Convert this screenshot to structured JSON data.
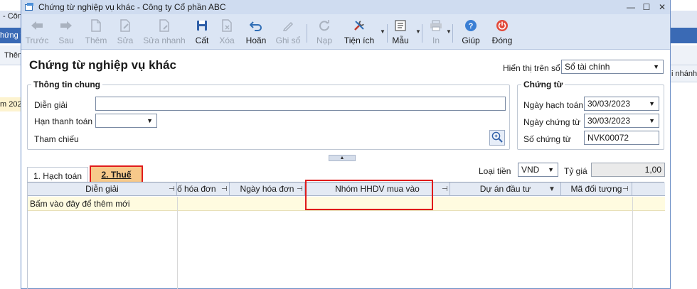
{
  "background": {
    "cong_text": "- Công",
    "nav_text": "hứng t",
    "them_text": "Thêm",
    "row_text": "m 202",
    "right_header": "i nhánh"
  },
  "window": {
    "title": "Chứng từ nghiệp vụ khác - Công ty Cổ phần ABC",
    "minimize": "—",
    "maximize": "☐",
    "close": "✕"
  },
  "toolbar": {
    "truoc": "Trước",
    "sau": "Sau",
    "them": "Thêm",
    "sua": "Sửa",
    "sua_nhanh": "Sửa nhanh",
    "cat": "Cất",
    "xoa": "Xóa",
    "hoan": "Hoãn",
    "ghi_so": "Ghi sổ",
    "nap": "Nạp",
    "tien_ich": "Tiện ích",
    "mau": "Mẫu",
    "in": "In",
    "giup": "Giúp",
    "dong": "Đóng"
  },
  "page": {
    "title": "Chứng từ nghiệp vụ khác",
    "hien_thi_label": "Hiển thị trên sổ",
    "hien_thi_value": "Sổ tài chính"
  },
  "thong_tin_chung": {
    "title": "Thông tin chung",
    "dien_giai_label": "Diễn giải",
    "dien_giai_value": "",
    "han_thanh_toan_label": "Hạn thanh toán",
    "han_thanh_toan_value": "",
    "tham_chieu_label": "Tham chiếu"
  },
  "chung_tu": {
    "title": "Chứng từ",
    "ngay_hach_toan_label": "Ngày hạch toán",
    "ngay_hach_toan_value": "30/03/2023",
    "ngay_chung_tu_label": "Ngày chứng từ",
    "ngay_chung_tu_value": "30/03/2023",
    "so_chung_tu_label": "Số chứng từ",
    "so_chung_tu_value": "NVK00072"
  },
  "tabs": {
    "hach_toan": "1. Hạch toán",
    "thue": "2. Thuế"
  },
  "currency": {
    "loai_tien_label": "Loại tiền",
    "loai_tien_value": "VND",
    "ty_gia_label": "Tỷ giá",
    "ty_gia_value": "1,00"
  },
  "grid": {
    "columns": [
      "Diễn giải",
      "ố hóa đơn",
      "Ngày hóa đơn",
      "Nhóm HHDV mua vào",
      "Dự án đầu tư",
      "Mã đối tượng"
    ],
    "new_row_text": "Bấm vào đây để thêm mới"
  },
  "colors": {
    "accent": "#3a6ab5",
    "highlight": "#e01b1b",
    "active_tab": "#f7c98a"
  }
}
